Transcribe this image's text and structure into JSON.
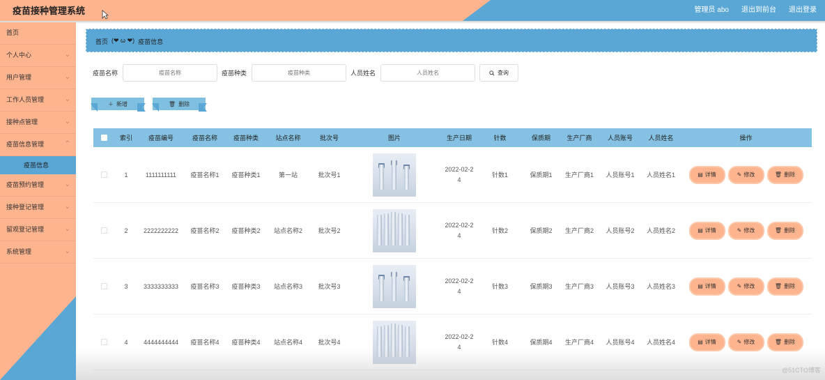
{
  "header": {
    "title": "疫苗接种管理系统",
    "admin": "管理员 abo",
    "front": "退出到前台",
    "logout": "退出登录"
  },
  "sidebar": {
    "items": [
      {
        "label": "首页"
      },
      {
        "label": "个人中心"
      },
      {
        "label": "用户管理"
      },
      {
        "label": "工作人员管理"
      },
      {
        "label": "接种点管理"
      },
      {
        "label": "疫苗信息管理"
      },
      {
        "label": "疫苗信息"
      },
      {
        "label": "疫苗预约管理"
      },
      {
        "label": "接种登记管理"
      },
      {
        "label": "留观登记管理"
      },
      {
        "label": "系统管理"
      }
    ]
  },
  "breadcrumb": {
    "home": "首页",
    "face": "(❤ ω ❤)",
    "current": "疫苗信息"
  },
  "search": {
    "name_label": "疫苗名称",
    "name_placeholder": "疫苗名称",
    "type_label": "疫苗种类",
    "type_placeholder": "疫苗种类",
    "person_label": "人员姓名",
    "person_placeholder": "人员姓名",
    "query_label": "查询"
  },
  "actions": {
    "add_label": "新增",
    "delete_label": "删除"
  },
  "table": {
    "headers": [
      "索引",
      "疫苗编号",
      "疫苗名称",
      "疫苗种类",
      "站点名称",
      "批次号",
      "图片",
      "生产日期",
      "针数",
      "保质期",
      "生产厂商",
      "人员账号",
      "人员姓名",
      "操作"
    ],
    "ops": {
      "detail": "详情",
      "edit": "修改",
      "delete": "删除"
    },
    "rows": [
      {
        "idx": "1",
        "code": "1111111111",
        "name": "疫苗名称1",
        "type": "疫苗种类1",
        "site": "第一站",
        "batch": "批次号1",
        "date1": "2022-02-2",
        "date2": "4",
        "dose": "针数1",
        "period": "保质期1",
        "maker": "生产厂商1",
        "acct": "人员账号1",
        "pname": "人员姓名1"
      },
      {
        "idx": "2",
        "code": "2222222222",
        "name": "疫苗名称2",
        "type": "疫苗种类2",
        "site": "站点名称2",
        "batch": "批次号2",
        "date1": "2022-02-2",
        "date2": "4",
        "dose": "针数2",
        "period": "保质期2",
        "maker": "生产厂商2",
        "acct": "人员账号2",
        "pname": "人员姓名2"
      },
      {
        "idx": "3",
        "code": "3333333333",
        "name": "疫苗名称3",
        "type": "疫苗种类3",
        "site": "站点名称3",
        "batch": "批次号3",
        "date1": "2022-02-2",
        "date2": "4",
        "dose": "针数3",
        "period": "保质期3",
        "maker": "生产厂商3",
        "acct": "人员账号3",
        "pname": "人员姓名3"
      },
      {
        "idx": "4",
        "code": "4444444444",
        "name": "疫苗名称4",
        "type": "疫苗种类4",
        "site": "站点名称4",
        "batch": "批次号4",
        "date1": "2022-02-2",
        "date2": "4",
        "dose": "针数4",
        "period": "保质期4",
        "maker": "生产厂商4",
        "acct": "人员账号4",
        "pname": "人员姓名4"
      }
    ]
  },
  "watermark": "@51CTO博客",
  "colors": {
    "peach": "#fdb48f",
    "blue": "#5aa7d6",
    "header_row": "#85c1e2"
  }
}
